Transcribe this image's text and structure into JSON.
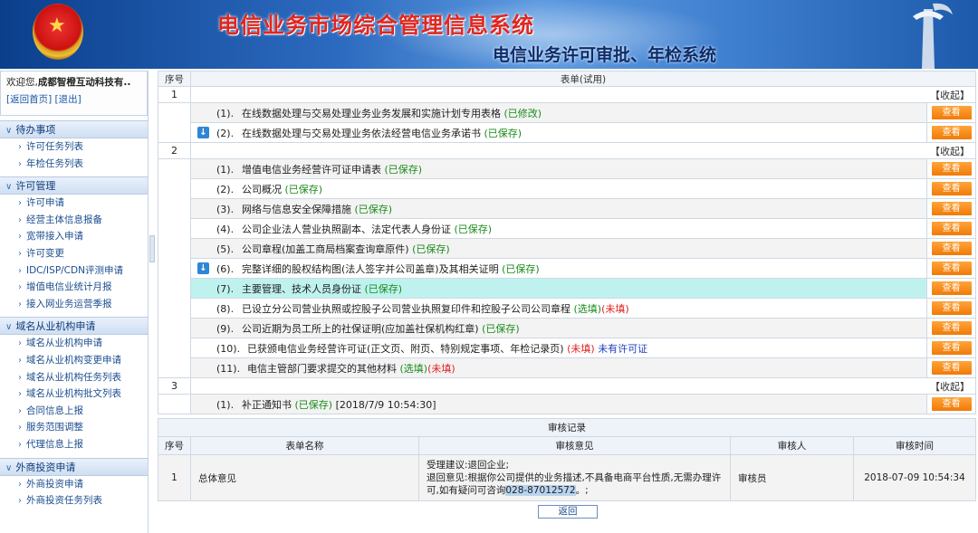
{
  "header": {
    "title": "电信业务市场综合管理信息系统",
    "subtitle": "电信业务许可审批、年检系统"
  },
  "sidebar": {
    "welcome_prefix": "欢迎您,",
    "user_name": "成都智橙互动科技有..",
    "home_link": "[返回首页]",
    "logout_link": "[退出]",
    "sections": [
      {
        "title": "待办事项",
        "items": [
          "许可任务列表",
          "年检任务列表"
        ]
      },
      {
        "title": "许可管理",
        "items": [
          "许可申请",
          "经营主体信息报备",
          "宽带接入申请",
          "许可变更",
          "IDC/ISP/CDN评测申请",
          "增值电信业统计月报",
          "接入网业务运营季报"
        ]
      },
      {
        "title": "域名从业机构申请",
        "items": [
          "域名从业机构申请",
          "域名从业机构变更申请",
          "域名从业机构任务列表",
          "域名从业机构批文列表",
          "合同信息上报",
          "服务范围调整",
          "代理信息上报"
        ]
      },
      {
        "title": "外商投资申请",
        "items": [
          "外商投资申请",
          "外商投资任务列表"
        ]
      }
    ]
  },
  "form": {
    "col_index": "序号",
    "col_form": "表单(试用)",
    "collapse_label": "【收起】",
    "view_label": "查看",
    "groups": [
      {
        "num": "1",
        "items": [
          {
            "idx": "(1).",
            "text": "在线数据处理与交易处理业务业务发展和实施计划专用表格",
            "status": "(已修改)"
          },
          {
            "idx": "(2).",
            "text": "在线数据处理与交易处理业务依法经营电信业务承诺书",
            "status": "(已保存)"
          }
        ]
      },
      {
        "num": "2",
        "items": [
          {
            "idx": "(1).",
            "text": "增值电信业务经营许可证申请表",
            "status": "(已保存)"
          },
          {
            "idx": "(2).",
            "text": "公司概况",
            "status": "(已保存)"
          },
          {
            "idx": "(3).",
            "text": "网络与信息安全保障措施",
            "status": "(已保存)"
          },
          {
            "idx": "(4).",
            "text": "公司企业法人营业执照副本、法定代表人身份证",
            "status": "(已保存)"
          },
          {
            "idx": "(5).",
            "text": "公司章程(加盖工商局档案查询章原件)",
            "status": "(已保存)"
          },
          {
            "idx": "(6).",
            "text": "完整详细的股权结构图(法人签字并公司盖章)及其相关证明",
            "status": "(已保存)"
          },
          {
            "idx": "(7).",
            "text": "主要管理、技术人员身份证",
            "status": "(已保存)"
          },
          {
            "idx": "(8).",
            "text": "已设立分公司营业执照或控股子公司营业执照复印件和控股子公司公司章程",
            "status_a": "(选填)",
            "status_b": "(未填)"
          },
          {
            "idx": "(9).",
            "text": "公司近期为员工所上的社保证明(应加盖社保机构红章)",
            "status": "(已保存)"
          },
          {
            "idx": "(10).",
            "text": "已获颁电信业务经营许可证(正文页、附页、特别规定事项、年检记录页)",
            "status_b": "(未填)",
            "status_c": "未有许可证"
          },
          {
            "idx": "(11).",
            "text": "电信主管部门要求提交的其他材料",
            "status_a": "(选填)",
            "status_b": "(未填)"
          }
        ]
      },
      {
        "num": "3",
        "items": [
          {
            "idx": "(1).",
            "text": "补正通知书",
            "status": "(已保存)",
            "time": "[2018/7/9 10:54:30]"
          }
        ]
      }
    ]
  },
  "audit": {
    "caption": "审核记录",
    "headers": [
      "序号",
      "表单名称",
      "审核意见",
      "审核人",
      "审核时间"
    ],
    "row": {
      "num": "1",
      "form_name": "总体意见",
      "opinion_line1": "受理建议:退回企业;",
      "opinion_line2": "退回意见:根据你公司提供的业务描述,不具备电商平台性质,无需办理许可,如有疑问可咨询",
      "opinion_phone": "028-87012572",
      "opinion_end": "。;",
      "reviewer": "审核员",
      "time": "2018-07-09 10:54:34"
    },
    "back_label": "返回"
  },
  "colors": {
    "accent_orange": "#f17a07",
    "status_green": "#1a8a1a",
    "status_red": "#e02020",
    "highlight_row": "#bff2ef",
    "title_red": "#e0261f"
  }
}
